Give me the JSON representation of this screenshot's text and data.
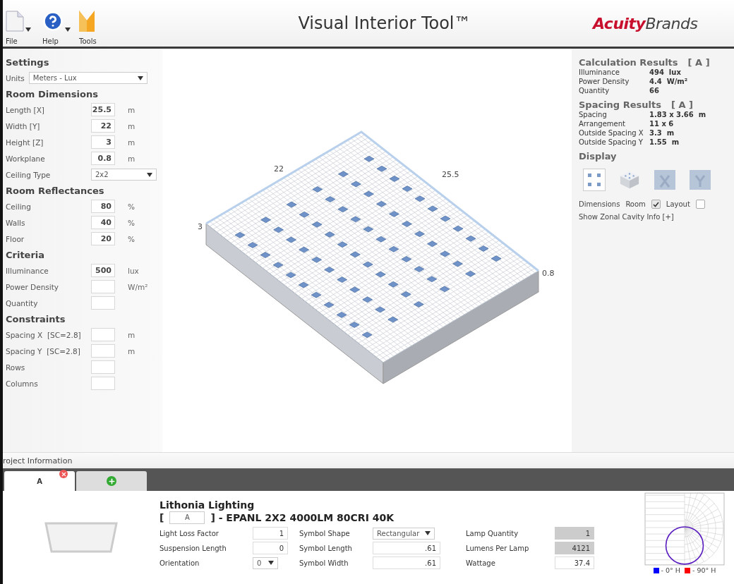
{
  "toolbar": [
    {
      "label": "File",
      "kind": "file",
      "dropdown": true
    },
    {
      "label": "Help",
      "kind": "help",
      "dropdown": true
    },
    {
      "label": "Tools",
      "kind": "tools",
      "dropdown": false
    }
  ],
  "title": "Visual Interior Tool™",
  "brand": "**Acuity**Brands",
  "settings": [
    {
      "title": "Settings",
      "rows": [
        {
          "kind": "select-wide",
          "label": "Units",
          "value": "Meters - Lux"
        }
      ]
    },
    {
      "title": "Room Dimensions",
      "rows": [
        {
          "kind": "input",
          "label": "Length [X]",
          "value": "25.5",
          "unit": "m"
        },
        {
          "kind": "input",
          "label": "Width [Y]",
          "value": "22",
          "unit": "m"
        },
        {
          "kind": "input",
          "label": "Height [Z]",
          "value": "3",
          "unit": "m"
        },
        {
          "kind": "input",
          "label": "Workplane",
          "value": "0.8",
          "unit": "m"
        },
        {
          "kind": "select",
          "label": "Ceiling Type",
          "value": "2x2"
        }
      ]
    },
    {
      "title": "Room Reflectances",
      "rows": [
        {
          "kind": "input",
          "label": "Ceiling",
          "value": "80",
          "unit": "%"
        },
        {
          "kind": "input",
          "label": "Walls",
          "value": "40",
          "unit": "%"
        },
        {
          "kind": "input",
          "label": "Floor",
          "value": "20",
          "unit": "%"
        }
      ]
    },
    {
      "title": "Criteria",
      "rows": [
        {
          "kind": "input",
          "label": "Illuminance",
          "value": "500",
          "unit": "lux"
        },
        {
          "kind": "input",
          "label": "Power Density",
          "unit": "W/m²"
        },
        {
          "kind": "input",
          "label": "Quantity"
        }
      ]
    },
    {
      "title": "Constraints",
      "rows": [
        {
          "kind": "input",
          "label": "Spacing X  [SC=2.8]",
          "unit": "m"
        },
        {
          "kind": "input",
          "label": "Spacing Y  [SC=2.8]",
          "unit": "m"
        },
        {
          "kind": "input",
          "label": "Rows"
        },
        {
          "kind": "input",
          "label": "Columns"
        }
      ]
    }
  ],
  "room_view": {
    "width_label": "22",
    "length_label": "25.5",
    "height_label": "3",
    "workplane_label": "0.8"
  },
  "results": [
    {
      "title": "Calculation Results",
      "tag": "[ A ]",
      "rows": [
        {
          "label": "Illuminance",
          "value": "494  lux"
        },
        {
          "label": "Power Density",
          "value": "4.4  W/m²"
        },
        {
          "label": "Quantity",
          "value": "66"
        }
      ]
    },
    {
      "title": "Spacing Results",
      "tag": "[ A ]",
      "rows": [
        {
          "label": "Spacing",
          "value": "1.83 x 3.66  m"
        },
        {
          "label": "Arrangement",
          "value": "11 x 6"
        },
        {
          "label": "Outside Spacing X",
          "value": "3.3  m"
        },
        {
          "label": "Outside Spacing Y",
          "value": "1.55  m"
        }
      ]
    }
  ],
  "display": {
    "title": "Display",
    "views": [
      {
        "kind": "plan",
        "selected": true
      },
      {
        "kind": "cube",
        "selected": false
      },
      {
        "kind": "x",
        "selected": false
      },
      {
        "kind": "y",
        "selected": false
      }
    ],
    "dimensions_label": "Dimensions",
    "options": [
      {
        "label": "Room",
        "checked": true
      },
      {
        "label": "Layout",
        "checked": false
      }
    ],
    "link": "Show Zonal Cavity Info [+]"
  },
  "project_bar": "roject Information",
  "tabs": [
    {
      "kind": "fixture",
      "label": "A",
      "selected": true
    },
    {
      "kind": "add",
      "selected": false
    }
  ],
  "fixture": {
    "manufacturer": "Lithonia Lighting",
    "open_bracket": "[",
    "type": "A",
    "description": "] - EPANL 2X2 4000LM 80CRI 40K",
    "field_rows": [
      [
        {
          "label": "Light Loss Factor",
          "value": "1",
          "kind": "input"
        },
        {
          "label": "Symbol Shape",
          "value": "Rectangular",
          "kind": "select"
        },
        {
          "label": "Lamp Quantity",
          "value": "1",
          "kind": "readonly"
        }
      ],
      [
        {
          "label": "Suspension Length",
          "value": "0",
          "kind": "input"
        },
        {
          "label": "Symbol Length",
          "value": ".61",
          "kind": "input"
        },
        {
          "label": "Lumens Per Lamp",
          "value": "4121",
          "kind": "readonly"
        }
      ],
      [
        {
          "label": "Orientation",
          "value": "0",
          "kind": "select"
        },
        {
          "label": "Symbol Width",
          "value": ".61",
          "kind": "input"
        },
        {
          "label": "Wattage",
          "value": "37.4",
          "kind": "input"
        }
      ]
    ],
    "legend": [
      {
        "label": "- 0° H",
        "color": "#0000ff"
      },
      {
        "label": "- 90° H",
        "color": "#ff0000"
      }
    ]
  }
}
